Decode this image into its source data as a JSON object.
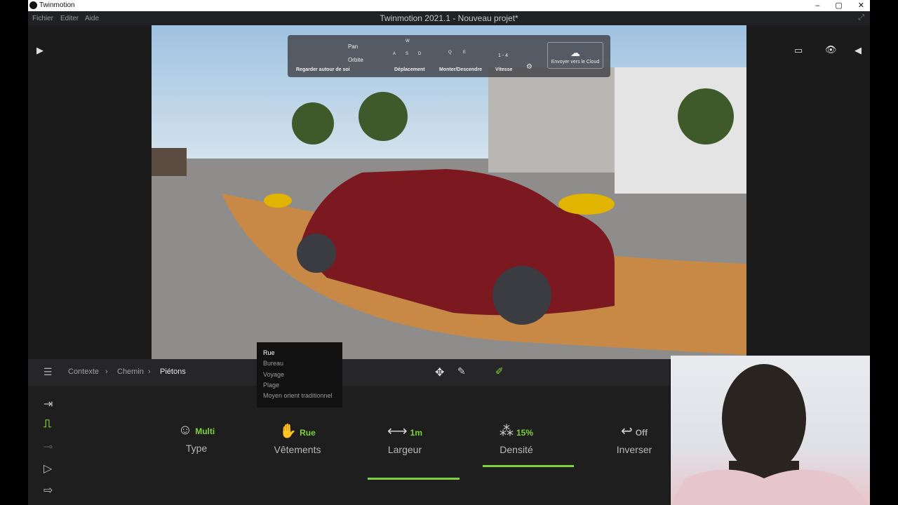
{
  "window": {
    "app_name": "Twinmotion",
    "controls": [
      "–",
      "▢",
      "✕"
    ]
  },
  "menu": {
    "items": [
      "Fichier",
      "Editer",
      "Aide"
    ],
    "title": "Twinmotion 2021.1 - Nouveau projet*"
  },
  "nav_hud": {
    "pan": "Pan",
    "orbit": "Orbite",
    "look": "Regarder autour de soi",
    "keys_move": [
      "W",
      "A",
      "S",
      "D"
    ],
    "move": "Déplacement",
    "keys_updown": [
      "Q",
      "E"
    ],
    "updown": "Monter/Descendre",
    "speed_keys": "1 - 4",
    "speed": "Vitesse",
    "cloud": "Envoyer vers le Cloud"
  },
  "breadcrumb": [
    "Contexte",
    "Chemin",
    "Piétons"
  ],
  "dropdown": {
    "options": [
      "Rue",
      "Bureau",
      "Voyage",
      "Plage",
      "Moyen orient traditionnel"
    ],
    "selected": "Rue"
  },
  "params": [
    {
      "name": "Type",
      "value": "Multi"
    },
    {
      "name": "Vêtements",
      "value": "Rue"
    },
    {
      "name": "Largeur",
      "value": "1m"
    },
    {
      "name": "Densité",
      "value": "15%"
    },
    {
      "name": "Inverser",
      "value": "Off"
    }
  ],
  "colors": {
    "accent": "#7ed23a",
    "panel": "#1e1e1f"
  }
}
